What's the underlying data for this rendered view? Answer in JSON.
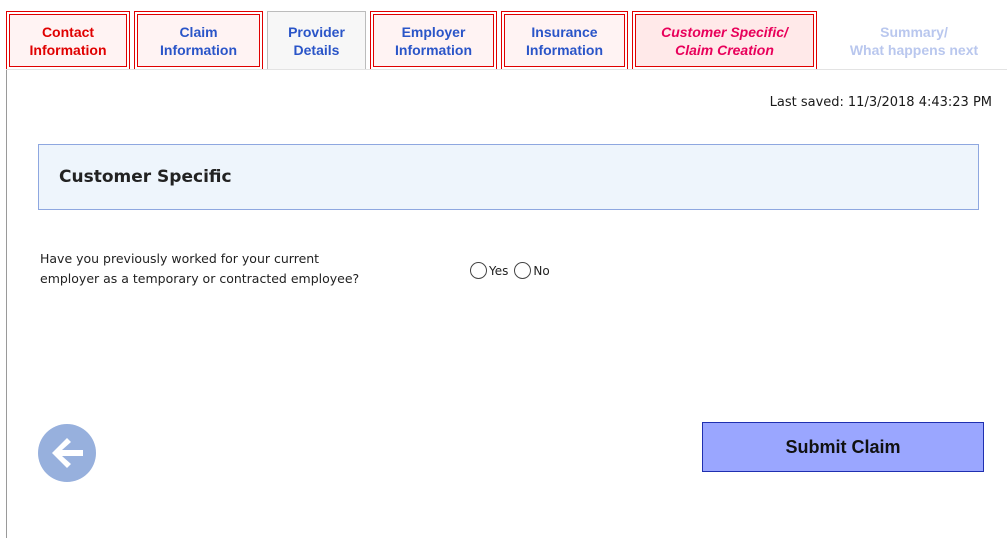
{
  "tabs": [
    {
      "label": "Contact\nInformation",
      "state": "done"
    },
    {
      "label": "Claim\nInformation",
      "state": "done"
    },
    {
      "label": "Provider\nDetails",
      "state": "neutral"
    },
    {
      "label": "Employer\nInformation",
      "state": "done"
    },
    {
      "label": "Insurance\nInformation",
      "state": "done"
    },
    {
      "label": "Customer Specific/\nClaim Creation",
      "state": "current"
    },
    {
      "label": "Summary/\nWhat happens next",
      "state": "disabled"
    }
  ],
  "last_saved": {
    "label": "Last saved:",
    "value": "11/3/2018 4:43:23 PM"
  },
  "section": {
    "title": "Customer Specific"
  },
  "question": {
    "text": "Have you previously worked for your current\nemployer as a temporary or contracted employee?",
    "options": [
      {
        "label": "Yes",
        "selected": false
      },
      {
        "label": "No",
        "selected": false
      }
    ]
  },
  "navigation": {
    "back_icon": "left-arrow-icon",
    "submit_label": "Submit Claim"
  },
  "colors": {
    "tab_border_red": "#e00000",
    "tab_text_blue": "#2a55c8",
    "current_tab_text": "#e8005a",
    "disabled_tab_text": "#b9c7ee",
    "section_header_bg": "#eef5fc",
    "section_header_border": "#8ea7e0",
    "submit_bg": "#9aa6ff",
    "submit_border": "#1f2fb0",
    "back_button_bg": "#97b0dd"
  }
}
